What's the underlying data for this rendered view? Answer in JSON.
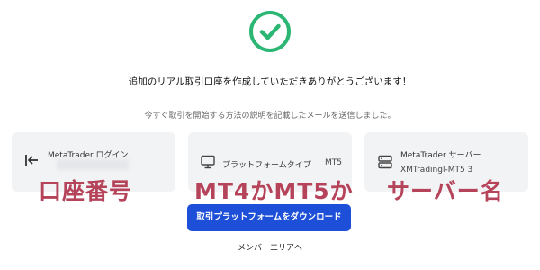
{
  "colors": {
    "success": "#2bb673",
    "primary_button": "#1e4fd8",
    "card_background": "#f2f3f5",
    "overlay_text": "#b5435a"
  },
  "header": {
    "icon": "check-circle-icon",
    "headline": "追加のリアル取引口座を作成していただきありがとうございます！",
    "subline": "今すぐ取引を開始する方法の説明を記載したメールを送信しました。"
  },
  "cards": {
    "login": {
      "icon": "login-arrow-icon",
      "title": "MetaTrader ログイン"
    },
    "platform": {
      "icon": "monitor-icon",
      "title": "プラットフォームタイプ",
      "value": "MT5"
    },
    "server": {
      "icon": "server-icon",
      "title": "MetaTrader サーバー",
      "value": "XMTradingl-MT5 3"
    }
  },
  "overlays": {
    "account_number": "口座番号",
    "platform_type": "MT4かMT5か",
    "server_name": "サーバー名"
  },
  "actions": {
    "download_label": "取引プラットフォームをダウンロード",
    "member_area_label": "メンバーエリアへ"
  }
}
